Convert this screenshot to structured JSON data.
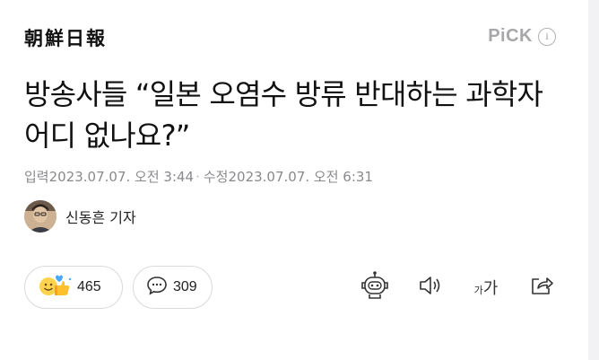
{
  "header": {
    "logo_text": "朝鮮日報",
    "pick_label": "PiCK",
    "info_symbol": "i"
  },
  "article": {
    "headline": "방송사들 “일본 오염수 방류 반대하는 과학자 어디 없나요?”",
    "published_label": "입력",
    "published": "2023.07.07. 오전 3:44",
    "separator": "·",
    "updated_label": "수정",
    "updated": "2023.07.07. 오전 6:31",
    "author": "신동흔 기자"
  },
  "actions": {
    "reactions_count": "465",
    "comments_count": "309",
    "font_small": "가",
    "font_big": "가"
  },
  "colors": {
    "background": "#f2f2f4",
    "card": "#ffffff",
    "meta_text": "#8a8a8e",
    "pick": "#a7a7aa"
  }
}
